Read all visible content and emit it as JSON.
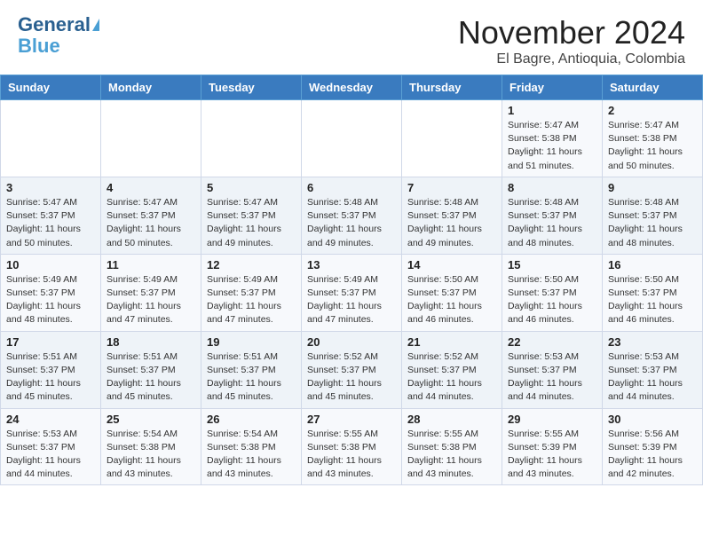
{
  "header": {
    "logo_line1": "General",
    "logo_line2": "Blue",
    "month": "November 2024",
    "location": "El Bagre, Antioquia, Colombia"
  },
  "weekdays": [
    "Sunday",
    "Monday",
    "Tuesday",
    "Wednesday",
    "Thursday",
    "Friday",
    "Saturday"
  ],
  "weeks": [
    [
      {
        "day": "",
        "info": ""
      },
      {
        "day": "",
        "info": ""
      },
      {
        "day": "",
        "info": ""
      },
      {
        "day": "",
        "info": ""
      },
      {
        "day": "",
        "info": ""
      },
      {
        "day": "1",
        "info": "Sunrise: 5:47 AM\nSunset: 5:38 PM\nDaylight: 11 hours\nand 51 minutes."
      },
      {
        "day": "2",
        "info": "Sunrise: 5:47 AM\nSunset: 5:38 PM\nDaylight: 11 hours\nand 50 minutes."
      }
    ],
    [
      {
        "day": "3",
        "info": "Sunrise: 5:47 AM\nSunset: 5:37 PM\nDaylight: 11 hours\nand 50 minutes."
      },
      {
        "day": "4",
        "info": "Sunrise: 5:47 AM\nSunset: 5:37 PM\nDaylight: 11 hours\nand 50 minutes."
      },
      {
        "day": "5",
        "info": "Sunrise: 5:47 AM\nSunset: 5:37 PM\nDaylight: 11 hours\nand 49 minutes."
      },
      {
        "day": "6",
        "info": "Sunrise: 5:48 AM\nSunset: 5:37 PM\nDaylight: 11 hours\nand 49 minutes."
      },
      {
        "day": "7",
        "info": "Sunrise: 5:48 AM\nSunset: 5:37 PM\nDaylight: 11 hours\nand 49 minutes."
      },
      {
        "day": "8",
        "info": "Sunrise: 5:48 AM\nSunset: 5:37 PM\nDaylight: 11 hours\nand 48 minutes."
      },
      {
        "day": "9",
        "info": "Sunrise: 5:48 AM\nSunset: 5:37 PM\nDaylight: 11 hours\nand 48 minutes."
      }
    ],
    [
      {
        "day": "10",
        "info": "Sunrise: 5:49 AM\nSunset: 5:37 PM\nDaylight: 11 hours\nand 48 minutes."
      },
      {
        "day": "11",
        "info": "Sunrise: 5:49 AM\nSunset: 5:37 PM\nDaylight: 11 hours\nand 47 minutes."
      },
      {
        "day": "12",
        "info": "Sunrise: 5:49 AM\nSunset: 5:37 PM\nDaylight: 11 hours\nand 47 minutes."
      },
      {
        "day": "13",
        "info": "Sunrise: 5:49 AM\nSunset: 5:37 PM\nDaylight: 11 hours\nand 47 minutes."
      },
      {
        "day": "14",
        "info": "Sunrise: 5:50 AM\nSunset: 5:37 PM\nDaylight: 11 hours\nand 46 minutes."
      },
      {
        "day": "15",
        "info": "Sunrise: 5:50 AM\nSunset: 5:37 PM\nDaylight: 11 hours\nand 46 minutes."
      },
      {
        "day": "16",
        "info": "Sunrise: 5:50 AM\nSunset: 5:37 PM\nDaylight: 11 hours\nand 46 minutes."
      }
    ],
    [
      {
        "day": "17",
        "info": "Sunrise: 5:51 AM\nSunset: 5:37 PM\nDaylight: 11 hours\nand 45 minutes."
      },
      {
        "day": "18",
        "info": "Sunrise: 5:51 AM\nSunset: 5:37 PM\nDaylight: 11 hours\nand 45 minutes."
      },
      {
        "day": "19",
        "info": "Sunrise: 5:51 AM\nSunset: 5:37 PM\nDaylight: 11 hours\nand 45 minutes."
      },
      {
        "day": "20",
        "info": "Sunrise: 5:52 AM\nSunset: 5:37 PM\nDaylight: 11 hours\nand 45 minutes."
      },
      {
        "day": "21",
        "info": "Sunrise: 5:52 AM\nSunset: 5:37 PM\nDaylight: 11 hours\nand 44 minutes."
      },
      {
        "day": "22",
        "info": "Sunrise: 5:53 AM\nSunset: 5:37 PM\nDaylight: 11 hours\nand 44 minutes."
      },
      {
        "day": "23",
        "info": "Sunrise: 5:53 AM\nSunset: 5:37 PM\nDaylight: 11 hours\nand 44 minutes."
      }
    ],
    [
      {
        "day": "24",
        "info": "Sunrise: 5:53 AM\nSunset: 5:37 PM\nDaylight: 11 hours\nand 44 minutes."
      },
      {
        "day": "25",
        "info": "Sunrise: 5:54 AM\nSunset: 5:38 PM\nDaylight: 11 hours\nand 43 minutes."
      },
      {
        "day": "26",
        "info": "Sunrise: 5:54 AM\nSunset: 5:38 PM\nDaylight: 11 hours\nand 43 minutes."
      },
      {
        "day": "27",
        "info": "Sunrise: 5:55 AM\nSunset: 5:38 PM\nDaylight: 11 hours\nand 43 minutes."
      },
      {
        "day": "28",
        "info": "Sunrise: 5:55 AM\nSunset: 5:38 PM\nDaylight: 11 hours\nand 43 minutes."
      },
      {
        "day": "29",
        "info": "Sunrise: 5:55 AM\nSunset: 5:39 PM\nDaylight: 11 hours\nand 43 minutes."
      },
      {
        "day": "30",
        "info": "Sunrise: 5:56 AM\nSunset: 5:39 PM\nDaylight: 11 hours\nand 42 minutes."
      }
    ]
  ]
}
